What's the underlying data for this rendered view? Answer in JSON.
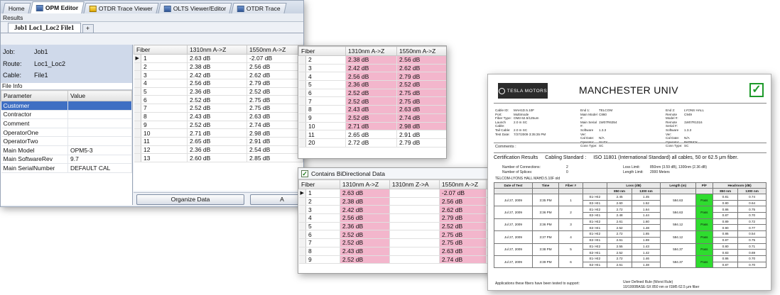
{
  "app": {
    "tabs": [
      {
        "label": "Home",
        "active": false
      },
      {
        "label": "OPM Editor",
        "active": true
      },
      {
        "label": "OTDR Trace Viewer",
        "active": false
      },
      {
        "label": "OLTS Viewer/Editor",
        "active": false
      },
      {
        "label": "OTDR Trace",
        "active": false
      }
    ],
    "results_label": "Results",
    "file_tab": "Job1 Loc1_Loc2 File1",
    "add_tab": "+"
  },
  "job": {
    "job_key": "Job:",
    "job_val": "Job1",
    "route_key": "Route:",
    "route_val": "Loc1_Loc2",
    "cable_key": "Cable:",
    "cable_val": "File1",
    "file_info": "File Info"
  },
  "params": {
    "headers": [
      "Parameter",
      "Value"
    ],
    "rows": [
      [
        "Customer",
        ""
      ],
      [
        "Contractor",
        ""
      ],
      [
        "Comment",
        ""
      ],
      [
        "OperatorOne",
        ""
      ],
      [
        "OperatorTwo",
        ""
      ],
      [
        "Main Model",
        "OPM5-3"
      ],
      [
        "Main SoftwareRev",
        "9.7"
      ],
      [
        "Main SerialNumber",
        "DEFAULT CAL"
      ]
    ],
    "selected_row": 0
  },
  "main_grid": {
    "headers": [
      "Fiber",
      "1310nm A->Z",
      "1550nm A->Z"
    ],
    "rows": [
      [
        "1",
        "2.63 dB",
        "-2.07 dB"
      ],
      [
        "2",
        "2.38 dB",
        "2.56 dB"
      ],
      [
        "3",
        "2.42 dB",
        "2.62 dB"
      ],
      [
        "4",
        "2.56 dB",
        "2.79 dB"
      ],
      [
        "5",
        "2.36 dB",
        "2.52 dB"
      ],
      [
        "6",
        "2.52 dB",
        "2.75 dB"
      ],
      [
        "7",
        "2.52 dB",
        "2.75 dB"
      ],
      [
        "8",
        "2.43 dB",
        "2.63 dB"
      ],
      [
        "9",
        "2.52 dB",
        "2.74 dB"
      ],
      [
        "10",
        "2.71 dB",
        "2.98 dB"
      ],
      [
        "11",
        "2.65 dB",
        "2.91 dB"
      ],
      [
        "12",
        "2.36 dB",
        "2.54 dB"
      ],
      [
        "13",
        "2.60 dB",
        "2.85 dB"
      ]
    ]
  },
  "buttons": {
    "organize": "Organize Data",
    "second": "A"
  },
  "mid_grid": {
    "headers": [
      "Fiber",
      "1310nm A->Z",
      "1550nm A->Z"
    ],
    "rows": [
      [
        "2",
        "2.38 dB",
        "2.56 dB",
        true
      ],
      [
        "3",
        "2.42 dB",
        "2.62 dB",
        true
      ],
      [
        "4",
        "2.56 dB",
        "2.79 dB",
        true
      ],
      [
        "5",
        "2.36 dB",
        "2.52 dB",
        true
      ],
      [
        "6",
        "2.52 dB",
        "2.75 dB",
        true
      ],
      [
        "7",
        "2.52 dB",
        "2.75 dB",
        true
      ],
      [
        "8",
        "2.43 dB",
        "2.63 dB",
        true
      ],
      [
        "9",
        "2.52 dB",
        "2.74 dB",
        true
      ],
      [
        "10",
        "2.71 dB",
        "2.98 dB",
        true
      ],
      [
        "11",
        "2.65 dB",
        "2.91 dB",
        false
      ],
      [
        "20",
        "2.72 dB",
        "2.79 dB",
        false
      ]
    ]
  },
  "bidir": {
    "checkbox_label": "Contains BiDirectional Data",
    "checked": true,
    "headers": [
      "Fiber",
      "1310nm A->Z",
      "1310nm Z->A",
      "1550nm A->Z",
      "15"
    ],
    "rows": [
      [
        "1",
        "2.63 dB",
        "",
        "-2.07 dB"
      ],
      [
        "2",
        "2.38 dB",
        "",
        "2.56 dB"
      ],
      [
        "3",
        "2.42 dB",
        "",
        "2.62 dB"
      ],
      [
        "4",
        "2.56 dB",
        "",
        "2.79 dB"
      ],
      [
        "5",
        "2.36 dB",
        "",
        "2.52 dB"
      ],
      [
        "6",
        "2.52 dB",
        "",
        "2.75 dB"
      ],
      [
        "7",
        "2.52 dB",
        "",
        "2.75 dB"
      ],
      [
        "8",
        "2.43 dB",
        "",
        "2.63 dB"
      ],
      [
        "9",
        "2.52 dB",
        "",
        "2.74 dB"
      ]
    ]
  },
  "report": {
    "logo_text": "TESLA MOTORS",
    "title": "MANCHESTER UNIV",
    "pass_mark": "✓",
    "meta_col1": [
      [
        "Cable ID:",
        "MAH1D.5.10F"
      ],
      [
        "Port:",
        "Multimode"
      ],
      [
        "Fiber Type:",
        "OM3 62.5/125um"
      ],
      [
        "Launch Cable:",
        "2.0 m  SC"
      ],
      [
        "Tail Cable:",
        "2.0 m  SC"
      ],
      [
        "Test Date:",
        "7/27/2009 3:35:35 PM"
      ]
    ],
    "meta_col2": [
      [
        "End 1:",
        "TELCOM"
      ],
      [
        "Main Model #:",
        "C860"
      ],
      [
        "Main Serial #:",
        "1W07R6354"
      ],
      [
        "Software Ver:",
        "1.3.3"
      ],
      [
        "Cal Date:",
        "N/A"
      ],
      [
        "Operator:",
        "SUZY"
      ],
      [
        "Conn Type:",
        "SC"
      ]
    ],
    "meta_col3": [
      [
        "End 2:",
        "LYONS HALL"
      ],
      [
        "Remote Model #:",
        "C949"
      ],
      [
        "Remote Serial #:",
        "1W07R1016"
      ],
      [
        "Software Ver:",
        "1.3.3"
      ],
      [
        "Cal Date:",
        "N/A"
      ],
      [
        "Operator:",
        "PATRICK"
      ],
      [
        "Conn Type:",
        "SC"
      ]
    ],
    "comments_label": "Comments :",
    "cert_label": "Certification Results",
    "standard_label": "Cabling Standard :",
    "standard_value": "ISO 11801 (International Standard) all cables, 50 or 62.5 μm fiber.",
    "connections_label": "Number of Connections:",
    "connections_val": "2",
    "splices_label": "Number of Splices:",
    "splices_val": "0",
    "loss_limit_label": "Loss Limit:",
    "loss_limit_val": "850nm (3.59 dB), 1300nm (2.36 dB)",
    "length_limit_label": "Length Limit:",
    "length_limit_val": "2000 Meters",
    "summary_line": "TELCOM-LYONS HALL MAHD.5.10F old",
    "table_headers": [
      "Date of Test",
      "Time",
      "Fiber #",
      "",
      "Loss (dB)",
      "",
      "Length (m)",
      "P/F",
      "Headroom (dB)",
      ""
    ],
    "table_subheaders": [
      "",
      "",
      "",
      "",
      "850 nm",
      "1300 nm",
      "",
      "",
      "850 nm",
      "1300 nm"
    ],
    "rows": [
      [
        "Jul 27, 2009",
        "3:35 PM",
        "1",
        [
          "E1->E2",
          "E2->E1"
        ],
        [
          "2.45",
          "2.60"
        ],
        [
          "1.45",
          "1.52"
        ],
        "594.63",
        "Pass",
        [
          "0.81",
          "0.80"
        ],
        [
          "0.74",
          "0.64"
        ]
      ],
      [
        "Jul 27, 2009",
        "3:36 PM",
        "2",
        [
          "E1->E2",
          "E2->E1"
        ],
        [
          "2.72",
          "2.48"
        ],
        [
          "1.64",
          "1.44"
        ],
        "594.63",
        "Pass",
        [
          "0.86",
          "0.87"
        ],
        [
          "0.75",
          "0.70"
        ]
      ],
      [
        "Jul 27, 2009",
        "3:36 PM",
        "3",
        [
          "E1->E2",
          "E2->E1"
        ],
        [
          "2.61",
          "2.52"
        ],
        [
          "1.60",
          "1.48"
        ],
        "594.12",
        "Pass",
        [
          "0.89",
          "0.90"
        ],
        [
          "0.72",
          "0.77"
        ]
      ],
      [
        "Jul 27, 2009",
        "3:37 PM",
        "4",
        [
          "E1->E2",
          "E2->E1"
        ],
        [
          "2.72",
          "2.61"
        ],
        [
          "1.65",
          "1.69"
        ],
        "594.12",
        "Pass",
        [
          "0.86",
          "0.87"
        ],
        [
          "0.54",
          "0.75"
        ]
      ],
      [
        "Jul 27, 2009",
        "3:38 PM",
        "5",
        [
          "E1->E2",
          "E2->E1"
        ],
        [
          "2.55",
          "2.52"
        ],
        [
          "1.43",
          "1.42"
        ],
        "594.37",
        "Pass",
        [
          "0.80",
          "0.83"
        ],
        [
          "0.71",
          "0.69"
        ]
      ],
      [
        "Jul 27, 2009",
        "3:39 PM",
        "6",
        [
          "E1->E2",
          "E2->E1"
        ],
        [
          "2.72",
          "2.61"
        ],
        [
          "1.46",
          "1.48"
        ],
        "594.37",
        "Pass",
        [
          "0.86",
          "0.87"
        ],
        [
          "0.70",
          "0.70"
        ]
      ]
    ],
    "footer_left": "Applications these fibers have been tested to support:",
    "footer_right_1": "User Defined Rule (Worst Rule)",
    "footer_right_2": "10/1000BASE-SX 850 nm or ISM5 62.5 μm fiber",
    "colors": {
      "pass_green": "#2fdc2f",
      "check_green": "#1d9a2a",
      "pink": "#f3b6cc",
      "selected": "#3f6fc3"
    }
  }
}
